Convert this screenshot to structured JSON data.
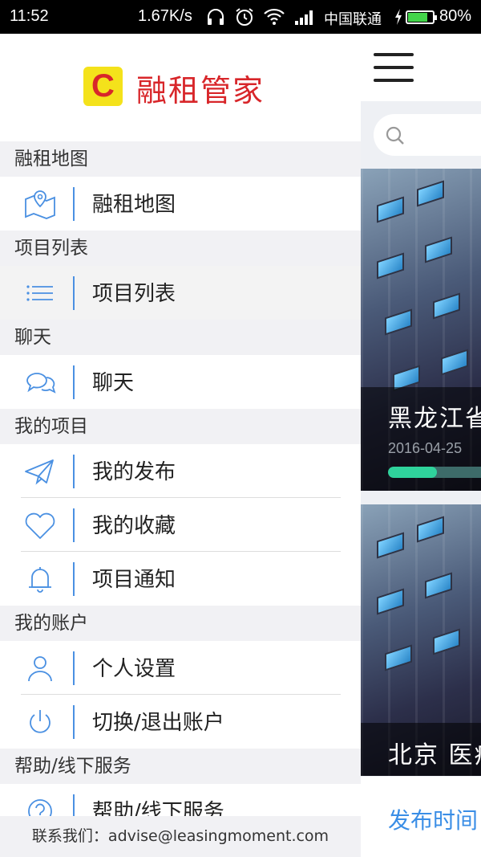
{
  "status_bar": {
    "time": "11:52",
    "speed": "1.67K/s",
    "carrier": "中国联通",
    "battery_percent": "80%",
    "battery_level": 0.8,
    "icons": [
      "headphones-icon",
      "alarm-icon",
      "wifi-icon",
      "signal-icon",
      "charging-icon",
      "battery-icon"
    ]
  },
  "drawer": {
    "brand": {
      "logo_letter": "C",
      "name": "融租管家"
    },
    "sections": [
      {
        "title": "融租地图",
        "items": [
          {
            "label": "融租地图",
            "icon": "map-pin-icon"
          }
        ]
      },
      {
        "title": "项目列表",
        "items": [
          {
            "label": "项目列表",
            "icon": "list-icon",
            "selected": true
          }
        ]
      },
      {
        "title": "聊天",
        "items": [
          {
            "label": "聊天",
            "icon": "chat-bubbles-icon"
          }
        ]
      },
      {
        "title": "我的项目",
        "items": [
          {
            "label": "我的发布",
            "icon": "paper-plane-icon"
          },
          {
            "label": "我的收藏",
            "icon": "heart-icon"
          },
          {
            "label": "项目通知",
            "icon": "bell-icon"
          }
        ]
      },
      {
        "title": "我的账户",
        "items": [
          {
            "label": "个人设置",
            "icon": "user-icon"
          },
          {
            "label": "切换/退出账户",
            "icon": "power-icon"
          }
        ]
      },
      {
        "title": "帮助/线下服务",
        "items": [
          {
            "label": "帮助/线下服务",
            "icon": "help-icon"
          }
        ]
      }
    ],
    "contact": "联系我们：advise@leasingmoment.com"
  },
  "main": {
    "cards": [
      {
        "title": "黑龙江省",
        "date": "2016-04-25",
        "progress": 0.47
      },
      {
        "title": "北京 医疗"
      }
    ],
    "sort_link": "发布时间"
  },
  "colors": {
    "brand_red": "#d8262a",
    "accent_blue": "#4a90e2",
    "progress_green": "#2fd39c"
  }
}
